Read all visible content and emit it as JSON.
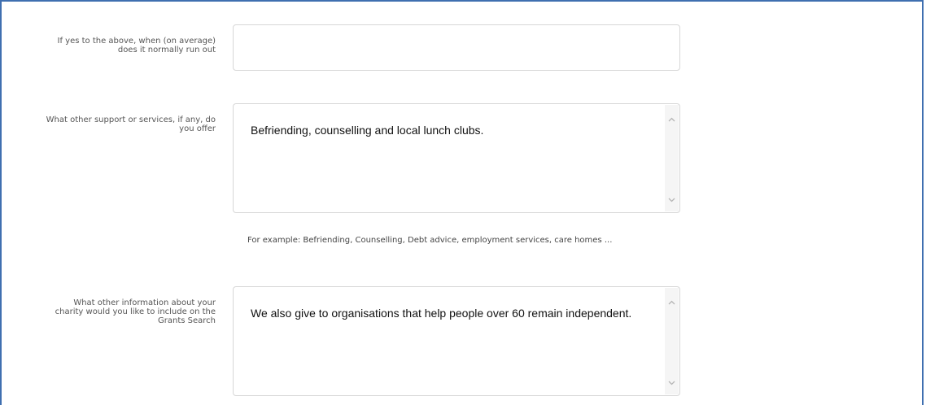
{
  "form": {
    "field1": {
      "label": "If yes to the above, when (on average) does it normally run out",
      "value": ""
    },
    "field2": {
      "label": "What other support or services, if any, do you offer",
      "value": "Befriending, counselling and local lunch clubs.",
      "helper": "For example: Befriending, Counselling, Debt advice, employment services, care homes ..."
    },
    "field3": {
      "label": "What other information about your charity would you like to include on the Grants Search",
      "value": "We also give to organisations that help people over 60 remain independent."
    }
  },
  "icons": {
    "scroll_up": "chevron-up-icon",
    "scroll_down": "chevron-down-icon"
  },
  "colors": {
    "frame_border": "#3f6fb0",
    "field_border": "#d7d7d7",
    "label_text": "#555555"
  }
}
